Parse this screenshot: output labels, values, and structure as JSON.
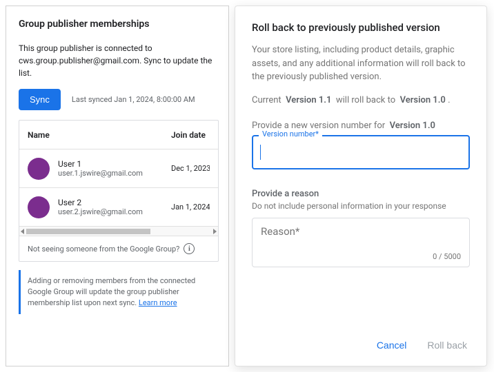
{
  "left": {
    "title": "Group publisher memberships",
    "desc": "This group publisher is connected to cws.group.publisher@gmail.com. Sync to update the list.",
    "sync_label": "Sync",
    "last_synced": "Last synced Jan 1, 2024, 8:00:00 AM",
    "col_name": "Name",
    "col_date": "Join date",
    "rows": [
      {
        "name": "User 1",
        "email": "user.1.jswire@gmail.com",
        "date": "Dec 1, 2023"
      },
      {
        "name": "User 2",
        "email": "user.2.jswire@gmail.com",
        "date": "Jan 1, 2024"
      }
    ],
    "not_seeing": "Not seeing someone from the Google Group?",
    "note_text": "Adding or removing members from the connected Google Group will update the group publisher membership list upon next sync. ",
    "note_link": "Learn more"
  },
  "right": {
    "title": "Roll back to previously published version",
    "desc": "Your store listing, including product details, graphic assets, and any additional information will roll back to the previously published version.",
    "current_label": "Current",
    "current_version": "Version 1.1",
    "will_label": "will roll back to",
    "target_version": "Version 1.0",
    "period": ".",
    "provide_version_label": "Provide a new version number for",
    "provide_version_for": "Version 1.0",
    "version_field_label": "Version number*",
    "version_value": "",
    "reason_heading": "Provide a reason",
    "reason_sub": "Do not include personal information in your response",
    "reason_placeholder": "Reason*",
    "char_count": "0 / 5000",
    "cancel": "Cancel",
    "rollback": "Roll back"
  }
}
